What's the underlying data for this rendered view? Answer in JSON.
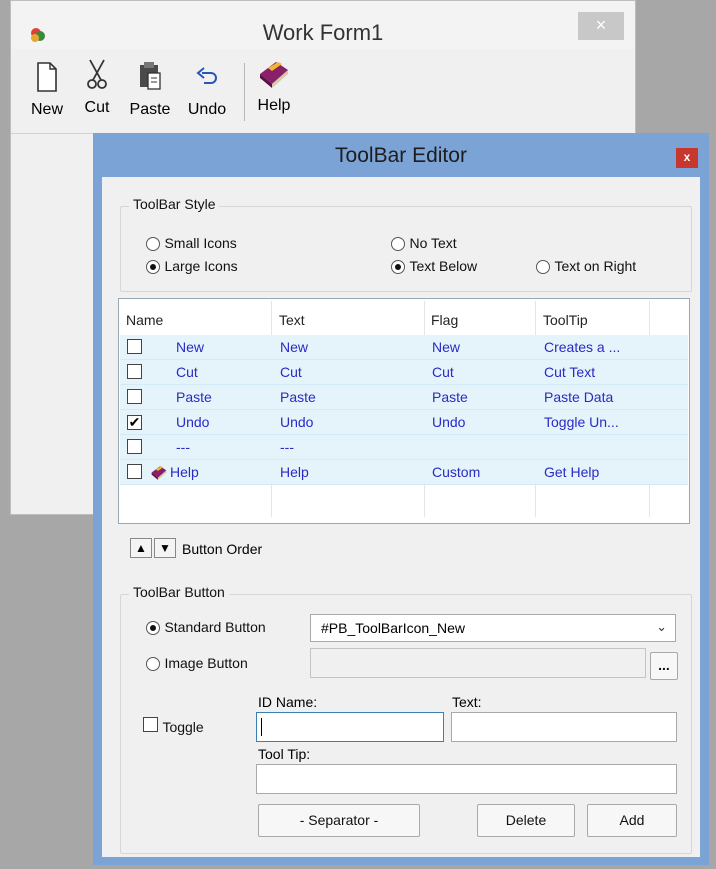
{
  "work_form": {
    "title": "Work Form1",
    "close_label": "×",
    "toolbar": [
      {
        "label": "New",
        "icon": "new-document-icon"
      },
      {
        "label": "Cut",
        "icon": "scissors-icon"
      },
      {
        "label": "Paste",
        "icon": "clipboard-icon"
      },
      {
        "label": "Undo",
        "icon": "undo-icon"
      },
      {
        "label": "Help",
        "icon": "help-book-icon"
      }
    ]
  },
  "editor": {
    "title": "ToolBar Editor",
    "close_label": "x",
    "style_group": {
      "label": "ToolBar Style",
      "small_icons": "Small Icons",
      "large_icons": "Large Icons",
      "no_text": "No Text",
      "text_below": "Text Below",
      "text_on_right": "Text on Right",
      "selected_icon_size": "Large Icons",
      "selected_text_position": "Text Below"
    },
    "list": {
      "columns": [
        "Name",
        "Text",
        "Flag",
        "ToolTip"
      ],
      "rows": [
        {
          "checked": false,
          "name": "New",
          "text": "New",
          "flag": "New",
          "tooltip": "Creates a ...",
          "icon": ""
        },
        {
          "checked": false,
          "name": "Cut",
          "text": "Cut",
          "flag": "Cut",
          "tooltip": "Cut Text",
          "icon": ""
        },
        {
          "checked": false,
          "name": "Paste",
          "text": "Paste",
          "flag": "Paste",
          "tooltip": "Paste Data",
          "icon": ""
        },
        {
          "checked": true,
          "name": "Undo",
          "text": "Undo",
          "flag": "Undo",
          "tooltip": "Toggle Un...",
          "icon": ""
        },
        {
          "checked": false,
          "name": "---",
          "text": "---",
          "flag": "",
          "tooltip": "",
          "icon": ""
        },
        {
          "checked": false,
          "name": "Help",
          "text": "Help",
          "flag": "Custom",
          "tooltip": "Get Help",
          "icon": "help-book-icon"
        }
      ]
    },
    "order": {
      "up": "▲",
      "down": "▼",
      "label": "Button Order"
    },
    "button_group": {
      "label": "ToolBar Button",
      "standard_button": "Standard Button",
      "image_button": "Image Button",
      "selected_type": "Standard Button",
      "standard_value": "#PB_ToolBarIcon_New",
      "image_value": "",
      "browse_label": "...",
      "toggle_label": "Toggle",
      "toggle_checked": false,
      "id_name_label": "ID Name:",
      "id_name_value": "",
      "text_label": "Text:",
      "text_value": "",
      "tooltip_label": "Tool Tip:",
      "tooltip_value": "",
      "separator_label": "- Separator -",
      "delete_label": "Delete",
      "add_label": "Add"
    }
  }
}
